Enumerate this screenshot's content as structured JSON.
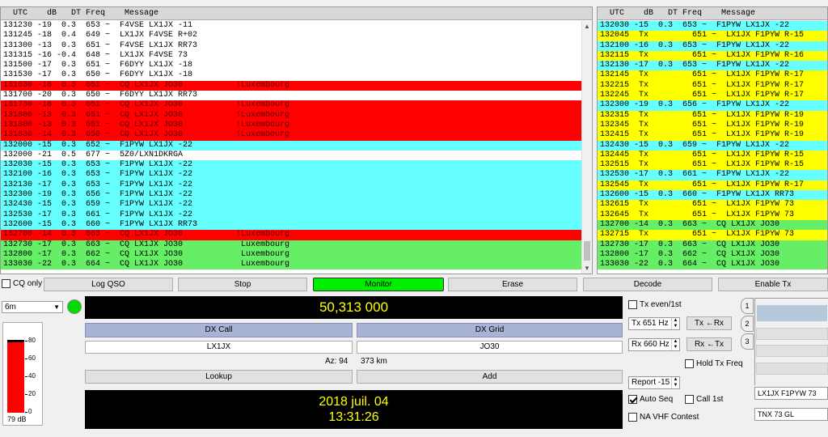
{
  "left_panel": {
    "header": "  UTC    dB   DT Freq    Message",
    "rows": [
      {
        "text": "131230 -19  0.3  653 ~  F4VSE LX1JX -11",
        "color": "white"
      },
      {
        "text": "131245 -18  0.4  649 ~  LX1JX F4VSE R+02",
        "color": "white"
      },
      {
        "text": "131300 -13  0.3  651 ~  F4VSE LX1JX RR73",
        "color": "white"
      },
      {
        "text": "131315 -16 -0.4  648 ~  LX1JX F4VSE 73",
        "color": "white"
      },
      {
        "text": "131500 -17  0.3  651 ~  F6DYY LX1JX -18",
        "color": "white"
      },
      {
        "text": "131530 -17  0.3  650 ~  F6DYY LX1JX -18",
        "color": "white"
      },
      {
        "text": "131630 -18  0.3  651 ~  CQ LX1JX JO30           !Luxembourg",
        "color": "red"
      },
      {
        "text": "131700 -20  0.3  650 ~  F6DYY LX1JX RR73",
        "color": "white"
      },
      {
        "text": "131730 -18  0.3  651 ~  CQ LX1JX JO30           !Luxembourg",
        "color": "red"
      },
      {
        "text": "131800 -13  0.3  651 ~  CQ LX1JX JO30           !Luxembourg",
        "color": "red"
      },
      {
        "text": "131800 -13  0.3  651 ~  CQ LX1JX JO30           !Luxembourg",
        "color": "red"
      },
      {
        "text": "131830 -14  0.3  650 ~  CQ LX1JX JO30           !Luxembourg",
        "color": "red"
      },
      {
        "text": "132000 -15  0.3  652 ~  F1PYW LX1JX -22",
        "color": "cyan"
      },
      {
        "text": "132000 -21  0.5  677 ~  5Z0/LXN1DKRGA",
        "color": "white"
      },
      {
        "text": "132030 -15  0.3  653 ~  F1PYW LX1JX -22",
        "color": "cyan"
      },
      {
        "text": "132100 -16  0.3  653 ~  F1PYW LX1JX -22",
        "color": "cyan"
      },
      {
        "text": "132130 -17  0.3  653 ~  F1PYW LX1JX -22",
        "color": "cyan"
      },
      {
        "text": "132300 -19  0.3  656 ~  F1PYW LX1JX -22",
        "color": "cyan"
      },
      {
        "text": "132430 -15  0.3  659 ~  F1PYW LX1JX -22",
        "color": "cyan"
      },
      {
        "text": "132530 -17  0.3  661 ~  F1PYW LX1JX -22",
        "color": "cyan"
      },
      {
        "text": "132600 -15  0.3  660 ~  F1PYW LX1JX RR73",
        "color": "cyan"
      },
      {
        "text": "132700 -14  0.3  663 ~  CQ LX1JX JO30           !Luxembourg",
        "color": "red"
      },
      {
        "text": "132730 -17  0.3  663 ~  CQ LX1JX JO30            Luxembourg",
        "color": "green"
      },
      {
        "text": "132800 -17  0.3  662 ~  CQ LX1JX JO30            Luxembourg",
        "color": "green"
      },
      {
        "text": "133030 -22  0.3  664 ~  CQ LX1JX JO30            Luxembourg",
        "color": "green"
      }
    ]
  },
  "right_panel": {
    "header": "  UTC    dB   DT Freq    Message",
    "rows": [
      {
        "text": "132030 -15  0.3  653 ~  F1PYW LX1JX -22",
        "color": "cyan"
      },
      {
        "text": "132045  Tx         651 ~  LX1JX F1PYW R-15",
        "color": "yellow"
      },
      {
        "text": "132100 -16  0.3  653 ~  F1PYW LX1JX -22",
        "color": "cyan"
      },
      {
        "text": "132115  Tx         651 ~  LX1JX F1PYW R-16",
        "color": "yellow"
      },
      {
        "text": "132130 -17  0.3  653 ~  F1PYW LX1JX -22",
        "color": "cyan"
      },
      {
        "text": "132145  Tx         651 ~  LX1JX F1PYW R-17",
        "color": "yellow"
      },
      {
        "text": "132215  Tx         651 ~  LX1JX F1PYW R-17",
        "color": "yellow"
      },
      {
        "text": "132245  Tx         651 ~  LX1JX F1PYW R-17",
        "color": "yellow"
      },
      {
        "text": "132300 -19  0.3  656 ~  F1PYW LX1JX -22",
        "color": "cyan"
      },
      {
        "text": "132315  Tx         651 ~  LX1JX F1PYW R-19",
        "color": "yellow"
      },
      {
        "text": "132345  Tx         651 ~  LX1JX F1PYW R-19",
        "color": "yellow"
      },
      {
        "text": "132415  Tx         651 ~  LX1JX F1PYW R-19",
        "color": "yellow"
      },
      {
        "text": "132430 -15  0.3  659 ~  F1PYW LX1JX -22",
        "color": "cyan"
      },
      {
        "text": "132445  Tx         651 ~  LX1JX F1PYW R-15",
        "color": "yellow"
      },
      {
        "text": "132515  Tx         651 ~  LX1JX F1PYW R-15",
        "color": "yellow"
      },
      {
        "text": "132530 -17  0.3  661 ~  F1PYW LX1JX -22",
        "color": "cyan"
      },
      {
        "text": "132545  Tx         651 ~  LX1JX F1PYW R-17",
        "color": "yellow"
      },
      {
        "text": "132600 -15  0.3  660 ~  F1PYW LX1JX RR73",
        "color": "cyan"
      },
      {
        "text": "132615  Tx         651 ~  LX1JX F1PYW 73",
        "color": "yellow"
      },
      {
        "text": "132645  Tx         651 ~  LX1JX F1PYW 73",
        "color": "yellow"
      },
      {
        "text": "132700 -14  0.3  663 ~  CQ LX1JX JO30",
        "color": "green"
      },
      {
        "text": "132715  Tx         651 ~  LX1JX F1PYW 73",
        "color": "yellow"
      },
      {
        "text": "132730 -17  0.3  663 ~  CQ LX1JX JO30",
        "color": "green"
      },
      {
        "text": "132800 -17  0.3  662 ~  CQ LX1JX JO30",
        "color": "green"
      },
      {
        "text": "133030 -22  0.3  664 ~  CQ LX1JX JO30",
        "color": "green"
      }
    ]
  },
  "buttons": {
    "cq_only": "CQ only",
    "log_qso": "Log QSO",
    "stop": "Stop",
    "monitor": "Monitor",
    "erase": "Erase",
    "decode": "Decode",
    "enable_tx": "Enable Tx",
    "lookup": "Lookup",
    "add": "Add",
    "tx_from_rx": "Tx ←Rx",
    "rx_from_tx": "Rx ←Tx"
  },
  "band": "6m",
  "meter": {
    "label": "79 dB",
    "ticks": [
      "80",
      "60",
      "40",
      "20",
      "0"
    ],
    "level_db": 79,
    "level_fraction": 0.99
  },
  "frequency": "50,313 000",
  "dx_call": {
    "label": "DX Call",
    "value": "LX1JX"
  },
  "dx_grid": {
    "label": "DX Grid",
    "value": "JO30"
  },
  "az": "Az: 94",
  "distance": "373 km",
  "clock": {
    "date": "2018 juil. 04",
    "time": "13:31:26"
  },
  "controls": {
    "tx_even": "Tx even/1st",
    "tx_hz": "Tx  651 Hz",
    "rx_hz": "Rx  660 Hz",
    "hold_tx": "Hold Tx Freq",
    "report": "Report -15",
    "auto_seq": "Auto Seq",
    "call_1st": "Call 1st",
    "na_vhf": "NA VHF Contest"
  },
  "tabs": [
    "1",
    "2",
    "3"
  ],
  "messages": {
    "tx_msg_1": "LX1JX F1PYW 73",
    "tx_msg_2": "TNX 73 GL"
  },
  "colors": {
    "red": "#ff0000",
    "cyan": "#66ffff",
    "green": "#66ee66",
    "yellow": "#ffff00",
    "monitor": "#00ee00",
    "display_fg": "#ffff00"
  }
}
